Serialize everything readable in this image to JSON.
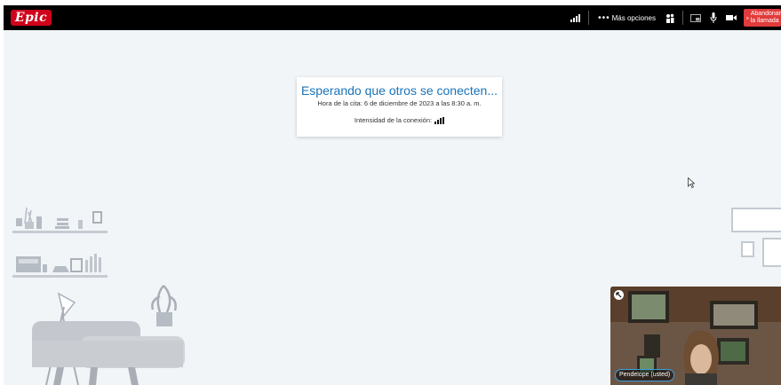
{
  "topbar": {
    "logo_text": "Epic",
    "more_options_label": "Más opciones",
    "leave_call_label": "Abandonar\nla llamada"
  },
  "waiting_card": {
    "title": "Esperando que otros se conecten...",
    "appointment_time": "Hora de la cita: 6 de diciembre de 2023 a las 8:30 a. m.",
    "connection_strength_label": "Intensidad de la conexión:"
  },
  "self_view": {
    "name_label": "Pendelope (usted)"
  },
  "colors": {
    "topbar_bg": "#000000",
    "logo_red": "#d0021b",
    "leave_red": "#e23b3b",
    "title_blue": "#1a73b8",
    "stage_bg": "#f1f5f8"
  },
  "icons": [
    "signal-bars-icon",
    "more-dots-icon",
    "participants-icon",
    "screen-share-icon",
    "microphone-icon",
    "camera-icon",
    "leave-call-icon",
    "collapse-arrow-icon",
    "mouse-cursor-icon"
  ]
}
